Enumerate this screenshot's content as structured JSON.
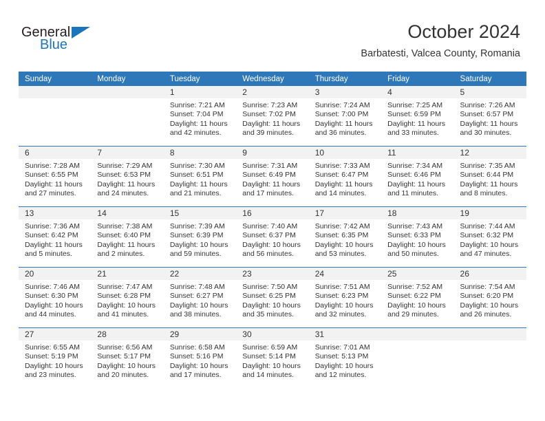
{
  "brand": {
    "name_top": "General",
    "name_bottom": "Blue",
    "triangle_icon": "triangle-logo-icon",
    "accent_color": "#1b75bb"
  },
  "header": {
    "title": "October 2024",
    "subtitle": "Barbatesti, Valcea County, Romania"
  },
  "theme": {
    "header_row_bg": "#2e77b8",
    "header_row_text": "#ffffff",
    "daynum_bg": "#f2f2f2",
    "body_text": "#333333",
    "row_divider": "#2e77b8"
  },
  "columns": [
    "Sunday",
    "Monday",
    "Tuesday",
    "Wednesday",
    "Thursday",
    "Friday",
    "Saturday"
  ],
  "labels": {
    "sunrise_prefix": "Sunrise:",
    "sunset_prefix": "Sunset:",
    "daylight_prefix": "Daylight:"
  },
  "weeks": [
    [
      {
        "day": "",
        "blank": true,
        "line1": "",
        "line2": "",
        "line3": "",
        "line4": ""
      },
      {
        "day": "",
        "blank": true,
        "line1": "",
        "line2": "",
        "line3": "",
        "line4": ""
      },
      {
        "day": "1",
        "line1": "Sunrise: 7:21 AM",
        "line2": "Sunset: 7:04 PM",
        "line3": "Daylight: 11 hours",
        "line4": "and 42 minutes."
      },
      {
        "day": "2",
        "line1": "Sunrise: 7:23 AM",
        "line2": "Sunset: 7:02 PM",
        "line3": "Daylight: 11 hours",
        "line4": "and 39 minutes."
      },
      {
        "day": "3",
        "line1": "Sunrise: 7:24 AM",
        "line2": "Sunset: 7:00 PM",
        "line3": "Daylight: 11 hours",
        "line4": "and 36 minutes."
      },
      {
        "day": "4",
        "line1": "Sunrise: 7:25 AM",
        "line2": "Sunset: 6:59 PM",
        "line3": "Daylight: 11 hours",
        "line4": "and 33 minutes."
      },
      {
        "day": "5",
        "line1": "Sunrise: 7:26 AM",
        "line2": "Sunset: 6:57 PM",
        "line3": "Daylight: 11 hours",
        "line4": "and 30 minutes."
      }
    ],
    [
      {
        "day": "6",
        "line1": "Sunrise: 7:28 AM",
        "line2": "Sunset: 6:55 PM",
        "line3": "Daylight: 11 hours",
        "line4": "and 27 minutes."
      },
      {
        "day": "7",
        "line1": "Sunrise: 7:29 AM",
        "line2": "Sunset: 6:53 PM",
        "line3": "Daylight: 11 hours",
        "line4": "and 24 minutes."
      },
      {
        "day": "8",
        "line1": "Sunrise: 7:30 AM",
        "line2": "Sunset: 6:51 PM",
        "line3": "Daylight: 11 hours",
        "line4": "and 21 minutes."
      },
      {
        "day": "9",
        "line1": "Sunrise: 7:31 AM",
        "line2": "Sunset: 6:49 PM",
        "line3": "Daylight: 11 hours",
        "line4": "and 17 minutes."
      },
      {
        "day": "10",
        "line1": "Sunrise: 7:33 AM",
        "line2": "Sunset: 6:47 PM",
        "line3": "Daylight: 11 hours",
        "line4": "and 14 minutes."
      },
      {
        "day": "11",
        "line1": "Sunrise: 7:34 AM",
        "line2": "Sunset: 6:46 PM",
        "line3": "Daylight: 11 hours",
        "line4": "and 11 minutes."
      },
      {
        "day": "12",
        "line1": "Sunrise: 7:35 AM",
        "line2": "Sunset: 6:44 PM",
        "line3": "Daylight: 11 hours",
        "line4": "and 8 minutes."
      }
    ],
    [
      {
        "day": "13",
        "line1": "Sunrise: 7:36 AM",
        "line2": "Sunset: 6:42 PM",
        "line3": "Daylight: 11 hours",
        "line4": "and 5 minutes."
      },
      {
        "day": "14",
        "line1": "Sunrise: 7:38 AM",
        "line2": "Sunset: 6:40 PM",
        "line3": "Daylight: 11 hours",
        "line4": "and 2 minutes."
      },
      {
        "day": "15",
        "line1": "Sunrise: 7:39 AM",
        "line2": "Sunset: 6:39 PM",
        "line3": "Daylight: 10 hours",
        "line4": "and 59 minutes."
      },
      {
        "day": "16",
        "line1": "Sunrise: 7:40 AM",
        "line2": "Sunset: 6:37 PM",
        "line3": "Daylight: 10 hours",
        "line4": "and 56 minutes."
      },
      {
        "day": "17",
        "line1": "Sunrise: 7:42 AM",
        "line2": "Sunset: 6:35 PM",
        "line3": "Daylight: 10 hours",
        "line4": "and 53 minutes."
      },
      {
        "day": "18",
        "line1": "Sunrise: 7:43 AM",
        "line2": "Sunset: 6:33 PM",
        "line3": "Daylight: 10 hours",
        "line4": "and 50 minutes."
      },
      {
        "day": "19",
        "line1": "Sunrise: 7:44 AM",
        "line2": "Sunset: 6:32 PM",
        "line3": "Daylight: 10 hours",
        "line4": "and 47 minutes."
      }
    ],
    [
      {
        "day": "20",
        "line1": "Sunrise: 7:46 AM",
        "line2": "Sunset: 6:30 PM",
        "line3": "Daylight: 10 hours",
        "line4": "and 44 minutes."
      },
      {
        "day": "21",
        "line1": "Sunrise: 7:47 AM",
        "line2": "Sunset: 6:28 PM",
        "line3": "Daylight: 10 hours",
        "line4": "and 41 minutes."
      },
      {
        "day": "22",
        "line1": "Sunrise: 7:48 AM",
        "line2": "Sunset: 6:27 PM",
        "line3": "Daylight: 10 hours",
        "line4": "and 38 minutes."
      },
      {
        "day": "23",
        "line1": "Sunrise: 7:50 AM",
        "line2": "Sunset: 6:25 PM",
        "line3": "Daylight: 10 hours",
        "line4": "and 35 minutes."
      },
      {
        "day": "24",
        "line1": "Sunrise: 7:51 AM",
        "line2": "Sunset: 6:23 PM",
        "line3": "Daylight: 10 hours",
        "line4": "and 32 minutes."
      },
      {
        "day": "25",
        "line1": "Sunrise: 7:52 AM",
        "line2": "Sunset: 6:22 PM",
        "line3": "Daylight: 10 hours",
        "line4": "and 29 minutes."
      },
      {
        "day": "26",
        "line1": "Sunrise: 7:54 AM",
        "line2": "Sunset: 6:20 PM",
        "line3": "Daylight: 10 hours",
        "line4": "and 26 minutes."
      }
    ],
    [
      {
        "day": "27",
        "line1": "Sunrise: 6:55 AM",
        "line2": "Sunset: 5:19 PM",
        "line3": "Daylight: 10 hours",
        "line4": "and 23 minutes."
      },
      {
        "day": "28",
        "line1": "Sunrise: 6:56 AM",
        "line2": "Sunset: 5:17 PM",
        "line3": "Daylight: 10 hours",
        "line4": "and 20 minutes."
      },
      {
        "day": "29",
        "line1": "Sunrise: 6:58 AM",
        "line2": "Sunset: 5:16 PM",
        "line3": "Daylight: 10 hours",
        "line4": "and 17 minutes."
      },
      {
        "day": "30",
        "line1": "Sunrise: 6:59 AM",
        "line2": "Sunset: 5:14 PM",
        "line3": "Daylight: 10 hours",
        "line4": "and 14 minutes."
      },
      {
        "day": "31",
        "line1": "Sunrise: 7:01 AM",
        "line2": "Sunset: 5:13 PM",
        "line3": "Daylight: 10 hours",
        "line4": "and 12 minutes."
      },
      {
        "day": "",
        "blank": true,
        "line1": "",
        "line2": "",
        "line3": "",
        "line4": ""
      },
      {
        "day": "",
        "blank": true,
        "line1": "",
        "line2": "",
        "line3": "",
        "line4": ""
      }
    ]
  ]
}
